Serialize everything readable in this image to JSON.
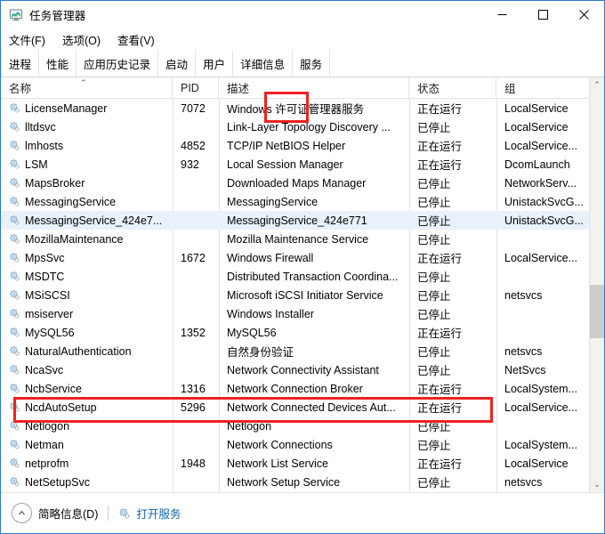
{
  "window": {
    "title": "任务管理器",
    "icon": "task-manager-icon",
    "controls": {
      "minimize": "–",
      "maximize": "□",
      "close": "✕"
    }
  },
  "menubar": {
    "items": [
      {
        "label": "文件(F)"
      },
      {
        "label": "选项(O)"
      },
      {
        "label": "查看(V)"
      }
    ]
  },
  "tabs": {
    "items": [
      {
        "label": "进程",
        "active": false
      },
      {
        "label": "性能",
        "active": false
      },
      {
        "label": "应用历史记录",
        "active": false
      },
      {
        "label": "启动",
        "active": false
      },
      {
        "label": "用户",
        "active": false
      },
      {
        "label": "详细信息",
        "active": false
      },
      {
        "label": "服务",
        "active": true
      }
    ],
    "highlighted": "服务"
  },
  "annotations": {
    "tab_box_color": "#ee2222",
    "row_box_color": "#ee2222",
    "highlighted_row": "MySQL56"
  },
  "table": {
    "columns": [
      {
        "key": "name",
        "label": "名称",
        "sorted": "asc",
        "sort_glyph": "⌃"
      },
      {
        "key": "pid",
        "label": "PID"
      },
      {
        "key": "description",
        "label": "描述"
      },
      {
        "key": "status",
        "label": "状态"
      },
      {
        "key": "group",
        "label": "组"
      }
    ],
    "rows": [
      {
        "name": "LicenseManager",
        "pid": "7072",
        "description": "Windows 许可证管理器服务",
        "status": "正在运行",
        "group": "LocalService",
        "selected": false
      },
      {
        "name": "lltdsvc",
        "pid": "",
        "description": "Link-Layer Topology Discovery ...",
        "status": "已停止",
        "group": "LocalService",
        "selected": false
      },
      {
        "name": "lmhosts",
        "pid": "4852",
        "description": "TCP/IP NetBIOS Helper",
        "status": "正在运行",
        "group": "LocalService...",
        "selected": false
      },
      {
        "name": "LSM",
        "pid": "932",
        "description": "Local Session Manager",
        "status": "正在运行",
        "group": "DcomLaunch",
        "selected": false
      },
      {
        "name": "MapsBroker",
        "pid": "",
        "description": "Downloaded Maps Manager",
        "status": "已停止",
        "group": "NetworkServ...",
        "selected": false
      },
      {
        "name": "MessagingService",
        "pid": "",
        "description": "MessagingService",
        "status": "已停止",
        "group": "UnistackSvcG...",
        "selected": false
      },
      {
        "name": "MessagingService_424e7...",
        "pid": "",
        "description": "MessagingService_424e771",
        "status": "已停止",
        "group": "UnistackSvcG...",
        "selected": true
      },
      {
        "name": "MozillaMaintenance",
        "pid": "",
        "description": "Mozilla Maintenance Service",
        "status": "已停止",
        "group": "",
        "selected": false
      },
      {
        "name": "MpsSvc",
        "pid": "1672",
        "description": "Windows Firewall",
        "status": "正在运行",
        "group": "LocalService...",
        "selected": false
      },
      {
        "name": "MSDTC",
        "pid": "",
        "description": "Distributed Transaction Coordina...",
        "status": "已停止",
        "group": "",
        "selected": false
      },
      {
        "name": "MSiSCSI",
        "pid": "",
        "description": "Microsoft iSCSI Initiator Service",
        "status": "已停止",
        "group": "netsvcs",
        "selected": false
      },
      {
        "name": "msiserver",
        "pid": "",
        "description": "Windows Installer",
        "status": "已停止",
        "group": "",
        "selected": false
      },
      {
        "name": "MySQL56",
        "pid": "1352",
        "description": "MySQL56",
        "status": "正在运行",
        "group": "",
        "selected": false
      },
      {
        "name": "NaturalAuthentication",
        "pid": "",
        "description": "自然身份验证",
        "status": "已停止",
        "group": "netsvcs",
        "selected": false
      },
      {
        "name": "NcaSvc",
        "pid": "",
        "description": "Network Connectivity Assistant",
        "status": "已停止",
        "group": "NetSvcs",
        "selected": false
      },
      {
        "name": "NcbService",
        "pid": "1316",
        "description": "Network Connection Broker",
        "status": "正在运行",
        "group": "LocalSystem...",
        "selected": false
      },
      {
        "name": "NcdAutoSetup",
        "pid": "5296",
        "description": "Network Connected Devices Aut...",
        "status": "正在运行",
        "group": "LocalService...",
        "selected": false
      },
      {
        "name": "Netlogon",
        "pid": "",
        "description": "Netlogon",
        "status": "已停止",
        "group": "",
        "selected": false
      },
      {
        "name": "Netman",
        "pid": "",
        "description": "Network Connections",
        "status": "已停止",
        "group": "LocalSystem...",
        "selected": false
      },
      {
        "name": "netprofm",
        "pid": "1948",
        "description": "Network List Service",
        "status": "正在运行",
        "group": "LocalService",
        "selected": false
      },
      {
        "name": "NetSetupSvc",
        "pid": "",
        "description": "Network Setup Service",
        "status": "已停止",
        "group": "netsvcs",
        "selected": false
      }
    ]
  },
  "scrollbar": {
    "up_glyph": "⌃",
    "down_glyph": "⌄"
  },
  "bottombar": {
    "fewer_details_label": "简略信息(D)",
    "open_services_label": "打开服务"
  }
}
